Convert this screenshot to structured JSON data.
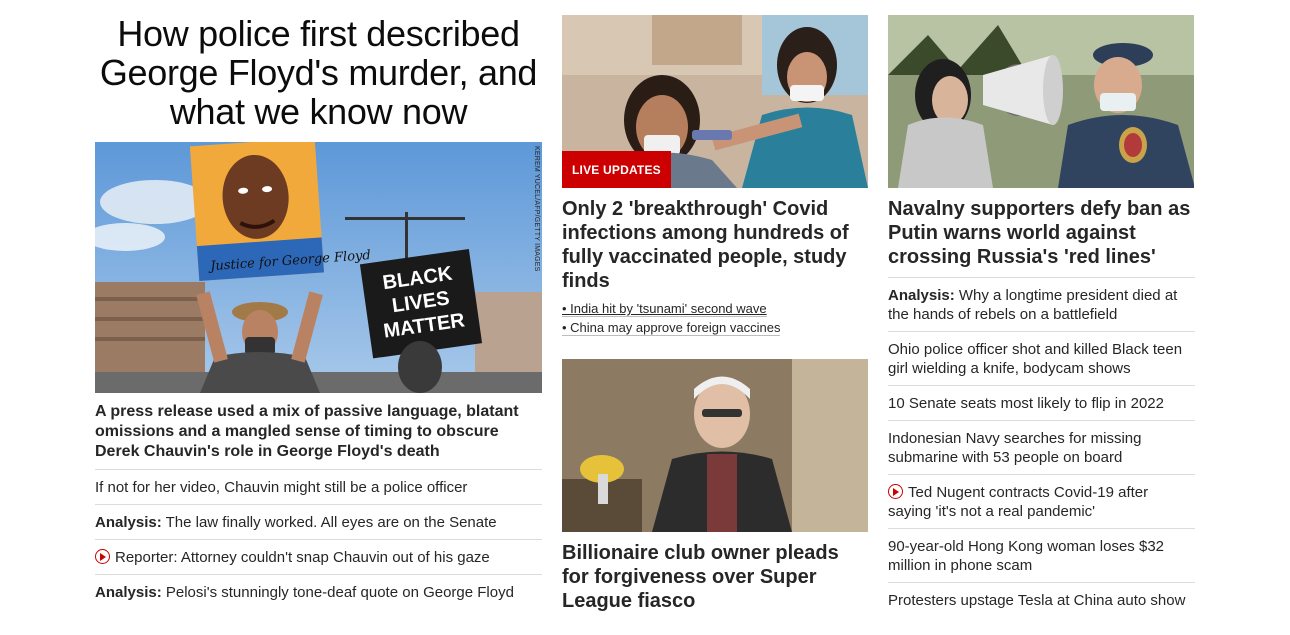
{
  "main": {
    "title": "How police first described George Floyd's murder, and what we know now",
    "hero_credit": "KEREM YUCEL/AFP/GETTY IMAGES",
    "hero_sign_text": "Justice for George Floyd",
    "hero_protest_sign": [
      "BLACK",
      "LIVES",
      "MATTER"
    ],
    "lead": "A press release used a mix of passive language, blatant omissions and a mangled sense of timing to obscure Derek Chauvin's role in George Floyd's death",
    "items": [
      {
        "prefix": "",
        "text": "If not for her video, Chauvin might still be a police officer",
        "video": false
      },
      {
        "prefix": "Analysis:",
        "text": " The law finally worked. All eyes are on the Senate",
        "video": false
      },
      {
        "prefix": "",
        "text": "Reporter: Attorney couldn't snap Chauvin out of his gaze",
        "video": true
      },
      {
        "prefix": "Analysis:",
        "text": " Pelosi's stunningly tone-deaf quote on George Floyd",
        "video": false
      }
    ]
  },
  "middle": {
    "badge": "LIVE UPDATES",
    "headline": "Only 2 'breakthrough' Covid infections among hundreds of fully vaccinated people, study finds",
    "bullets": [
      "• India hit by 'tsunami' second wave",
      "• China may approve foreign vaccines"
    ],
    "headline2": "Billionaire club owner pleads for forgiveness over Super League fiasco"
  },
  "right": {
    "headline": "Navalny supporters defy ban as Putin warns world against crossing Russia's 'red lines'",
    "items": [
      {
        "prefix": "Analysis:",
        "text": " Why a longtime president died at the hands of rebels on a battlefield",
        "video": false
      },
      {
        "prefix": "",
        "text": "Ohio police officer shot and killed Black teen girl wielding a knife, bodycam shows",
        "video": false
      },
      {
        "prefix": "",
        "text": "10 Senate seats most likely to flip in 2022",
        "video": false
      },
      {
        "prefix": "",
        "text": "Indonesian Navy searches for missing submarine with 53 people on board",
        "video": false
      },
      {
        "prefix": "",
        "text": "Ted Nugent contracts Covid-19 after saying 'it's not a real pandemic'",
        "video": true
      },
      {
        "prefix": "",
        "text": "90-year-old Hong Kong woman loses $32 million in phone scam",
        "video": false
      },
      {
        "prefix": "",
        "text": "Protesters upstage Tesla at China auto show",
        "video": false
      }
    ]
  },
  "colors": {
    "accent_red": "#cc0000",
    "text": "#262626",
    "divider": "#dcdcdc"
  }
}
